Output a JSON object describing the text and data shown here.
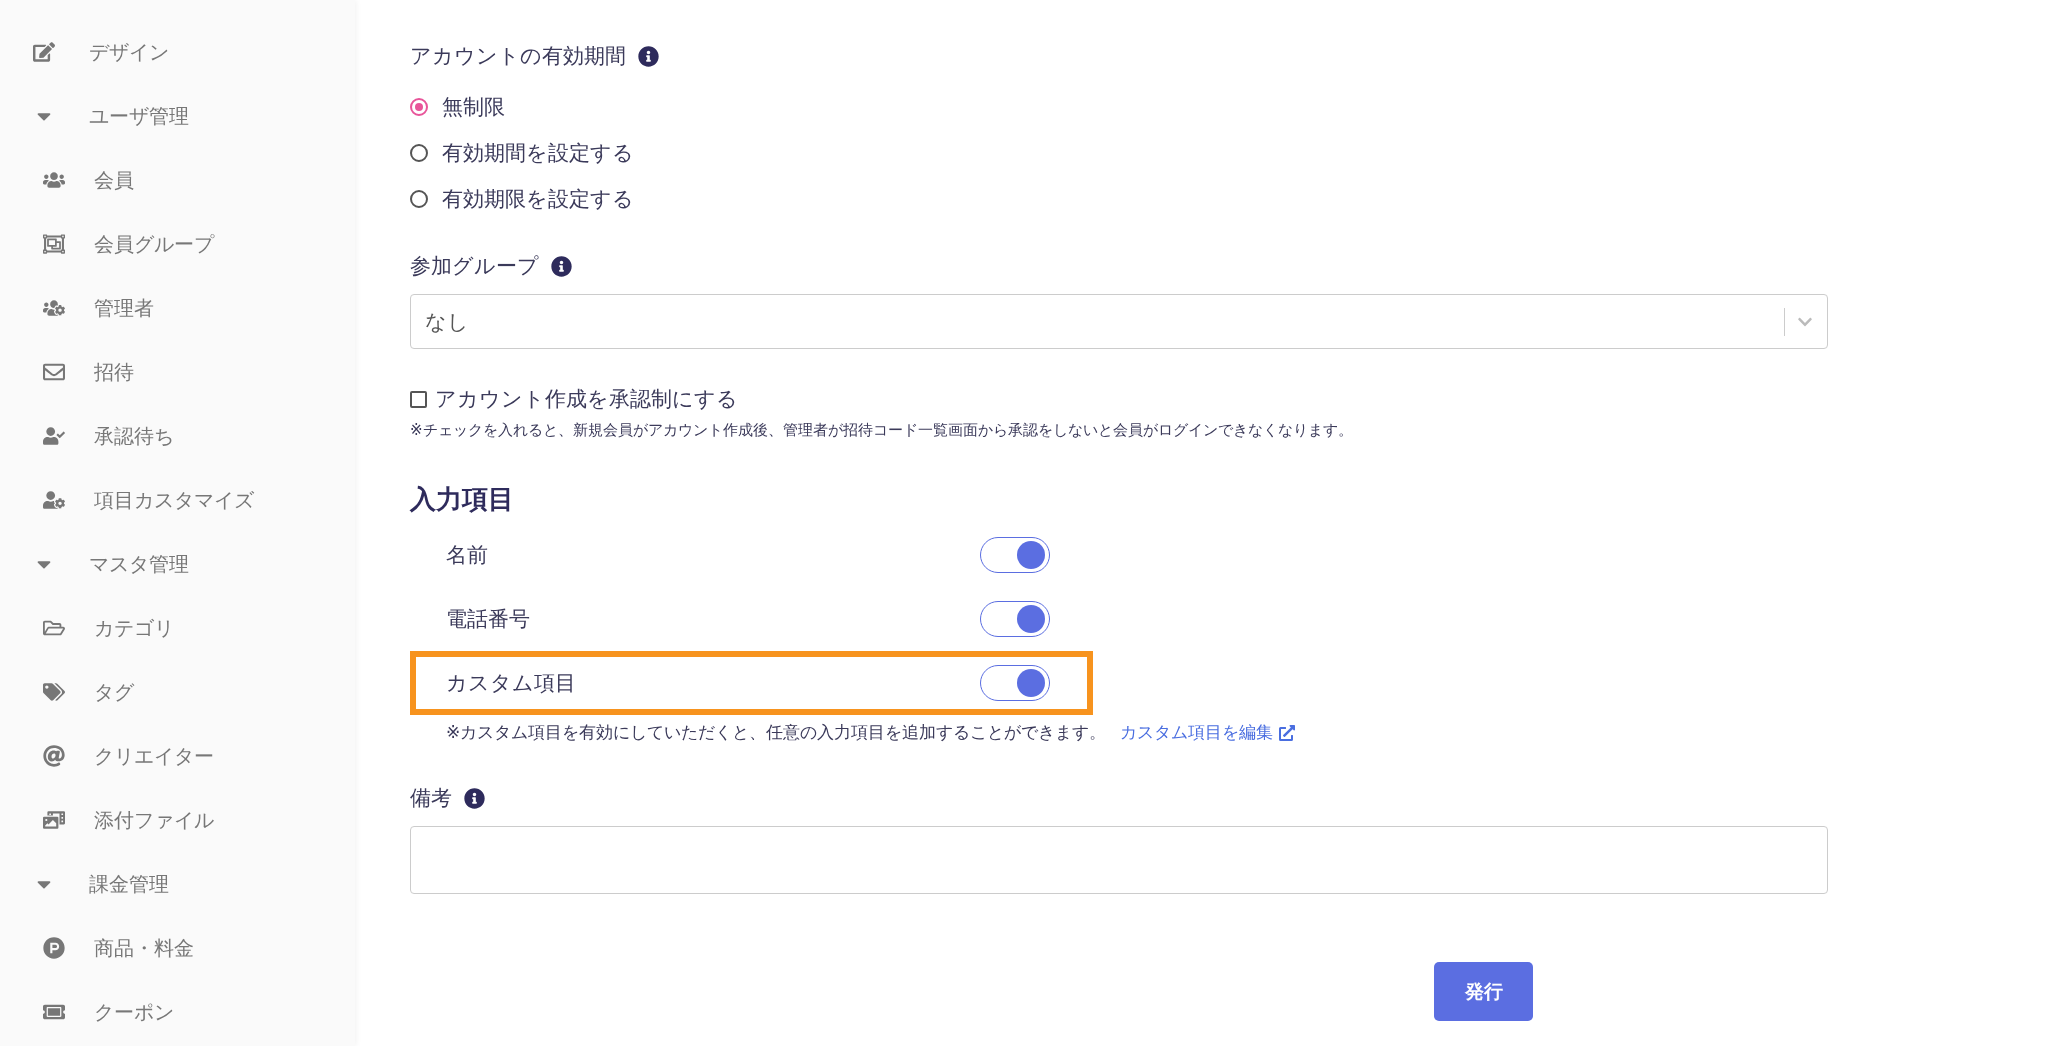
{
  "sidebar": {
    "items": [
      {
        "label": "デザイン"
      },
      {
        "label": "ユーザ管理",
        "expanded": true,
        "children": [
          {
            "label": "会員"
          },
          {
            "label": "会員グループ"
          },
          {
            "label": "管理者"
          },
          {
            "label": "招待"
          },
          {
            "label": "承認待ち"
          },
          {
            "label": "項目カスタマイズ"
          }
        ]
      },
      {
        "label": "マスタ管理",
        "expanded": true,
        "children": [
          {
            "label": "カテゴリ"
          },
          {
            "label": "タグ"
          },
          {
            "label": "クリエイター"
          },
          {
            "label": "添付ファイル"
          }
        ]
      },
      {
        "label": "課金管理",
        "expanded": true,
        "children": [
          {
            "label": "商品・料金"
          },
          {
            "label": "クーポン"
          }
        ]
      }
    ]
  },
  "account_period": {
    "label": "アカウントの有効期間",
    "options": [
      {
        "label": "無制限",
        "selected": true
      },
      {
        "label": "有効期間を設定する",
        "selected": false
      },
      {
        "label": "有効期限を設定する",
        "selected": false
      }
    ]
  },
  "group": {
    "label": "参加グループ",
    "value": "なし"
  },
  "approval": {
    "label": "アカウント作成を承認制にする",
    "checked": false,
    "note": "※チェックを入れると、新規会員がアカウント作成後、管理者が招待コード一覧画面から承認をしないと会員がログインできなくなります。"
  },
  "input_fields": {
    "heading": "入力項目",
    "items": [
      {
        "label": "名前",
        "on": true,
        "highlighted": false
      },
      {
        "label": "電話番号",
        "on": true,
        "highlighted": false
      },
      {
        "label": "カスタム項目",
        "on": true,
        "highlighted": true
      }
    ],
    "note": "※カスタム項目を有効にしていただくと、任意の入力項目を追加することができます。",
    "link": "カスタム項目を編集"
  },
  "remarks": {
    "label": "備考"
  },
  "submit": "発行"
}
